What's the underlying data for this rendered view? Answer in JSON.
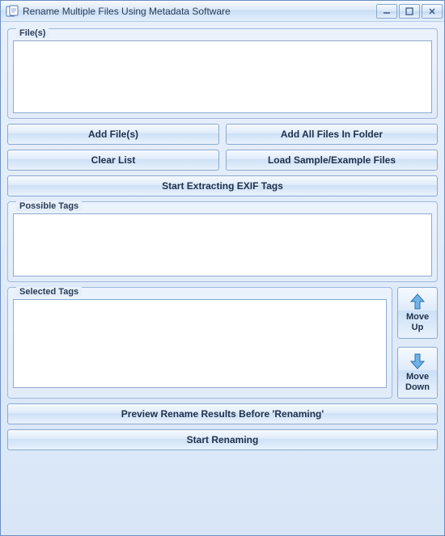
{
  "window": {
    "title": "Rename Multiple Files Using Metadata Software"
  },
  "groups": {
    "files": "File(s)",
    "possible_tags": "Possible Tags",
    "selected_tags": "Selected Tags"
  },
  "buttons": {
    "add_files": "Add File(s)",
    "add_all": "Add All Files In Folder",
    "clear_list": "Clear List",
    "load_sample": "Load Sample/Example Files",
    "start_extract": "Start Extracting EXIF Tags",
    "move_up": "Move Up",
    "move_down": "Move Down",
    "preview": "Preview Rename Results Before 'Renaming'",
    "start_rename": "Start Renaming"
  }
}
